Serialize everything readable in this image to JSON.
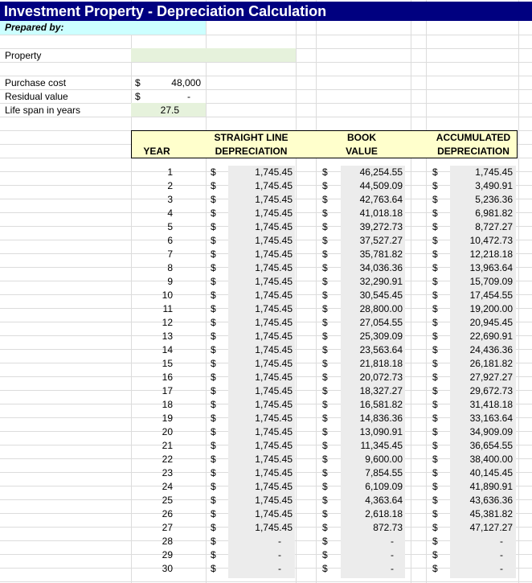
{
  "title": "Investment Property - Depreciation Calculation",
  "prepared_by_label": "Prepared by:",
  "property_label": "Property",
  "purchase_cost": {
    "label": "Purchase cost",
    "currency": "$",
    "value": "48,000"
  },
  "residual_value": {
    "label": "Residual value",
    "currency": "$",
    "value": "-"
  },
  "life_span": {
    "label": "Life span in years",
    "value": "27.5"
  },
  "headers": {
    "year": "YEAR",
    "sl_line1": "STRAIGHT LINE",
    "sl_line2": "DEPRECIATION",
    "bv_line1": "BOOK",
    "bv_line2": "VALUE",
    "ad_line1": "ACCUMULATED",
    "ad_line2": "DEPRECIATION"
  },
  "currency_symbol": "$",
  "rows": [
    {
      "year": "1",
      "sl": "1,745.45",
      "bv": "46,254.55",
      "ad": "1,745.45"
    },
    {
      "year": "2",
      "sl": "1,745.45",
      "bv": "44,509.09",
      "ad": "3,490.91"
    },
    {
      "year": "3",
      "sl": "1,745.45",
      "bv": "42,763.64",
      "ad": "5,236.36"
    },
    {
      "year": "4",
      "sl": "1,745.45",
      "bv": "41,018.18",
      "ad": "6,981.82"
    },
    {
      "year": "5",
      "sl": "1,745.45",
      "bv": "39,272.73",
      "ad": "8,727.27"
    },
    {
      "year": "6",
      "sl": "1,745.45",
      "bv": "37,527.27",
      "ad": "10,472.73"
    },
    {
      "year": "7",
      "sl": "1,745.45",
      "bv": "35,781.82",
      "ad": "12,218.18"
    },
    {
      "year": "8",
      "sl": "1,745.45",
      "bv": "34,036.36",
      "ad": "13,963.64"
    },
    {
      "year": "9",
      "sl": "1,745.45",
      "bv": "32,290.91",
      "ad": "15,709.09"
    },
    {
      "year": "10",
      "sl": "1,745.45",
      "bv": "30,545.45",
      "ad": "17,454.55"
    },
    {
      "year": "11",
      "sl": "1,745.45",
      "bv": "28,800.00",
      "ad": "19,200.00"
    },
    {
      "year": "12",
      "sl": "1,745.45",
      "bv": "27,054.55",
      "ad": "20,945.45"
    },
    {
      "year": "13",
      "sl": "1,745.45",
      "bv": "25,309.09",
      "ad": "22,690.91"
    },
    {
      "year": "14",
      "sl": "1,745.45",
      "bv": "23,563.64",
      "ad": "24,436.36"
    },
    {
      "year": "15",
      "sl": "1,745.45",
      "bv": "21,818.18",
      "ad": "26,181.82"
    },
    {
      "year": "16",
      "sl": "1,745.45",
      "bv": "20,072.73",
      "ad": "27,927.27"
    },
    {
      "year": "17",
      "sl": "1,745.45",
      "bv": "18,327.27",
      "ad": "29,672.73"
    },
    {
      "year": "18",
      "sl": "1,745.45",
      "bv": "16,581.82",
      "ad": "31,418.18"
    },
    {
      "year": "19",
      "sl": "1,745.45",
      "bv": "14,836.36",
      "ad": "33,163.64"
    },
    {
      "year": "20",
      "sl": "1,745.45",
      "bv": "13,090.91",
      "ad": "34,909.09"
    },
    {
      "year": "21",
      "sl": "1,745.45",
      "bv": "11,345.45",
      "ad": "36,654.55"
    },
    {
      "year": "22",
      "sl": "1,745.45",
      "bv": "9,600.00",
      "ad": "38,400.00"
    },
    {
      "year": "23",
      "sl": "1,745.45",
      "bv": "7,854.55",
      "ad": "40,145.45"
    },
    {
      "year": "24",
      "sl": "1,745.45",
      "bv": "6,109.09",
      "ad": "41,890.91"
    },
    {
      "year": "25",
      "sl": "1,745.45",
      "bv": "4,363.64",
      "ad": "43,636.36"
    },
    {
      "year": "26",
      "sl": "1,745.45",
      "bv": "2,618.18",
      "ad": "45,381.82"
    },
    {
      "year": "27",
      "sl": "1,745.45",
      "bv": "872.73",
      "ad": "47,127.27"
    },
    {
      "year": "28",
      "sl": "-",
      "bv": "-",
      "ad": "-"
    },
    {
      "year": "29",
      "sl": "-",
      "bv": "-",
      "ad": "-"
    },
    {
      "year": "30",
      "sl": "-",
      "bv": "-",
      "ad": "-"
    }
  ]
}
